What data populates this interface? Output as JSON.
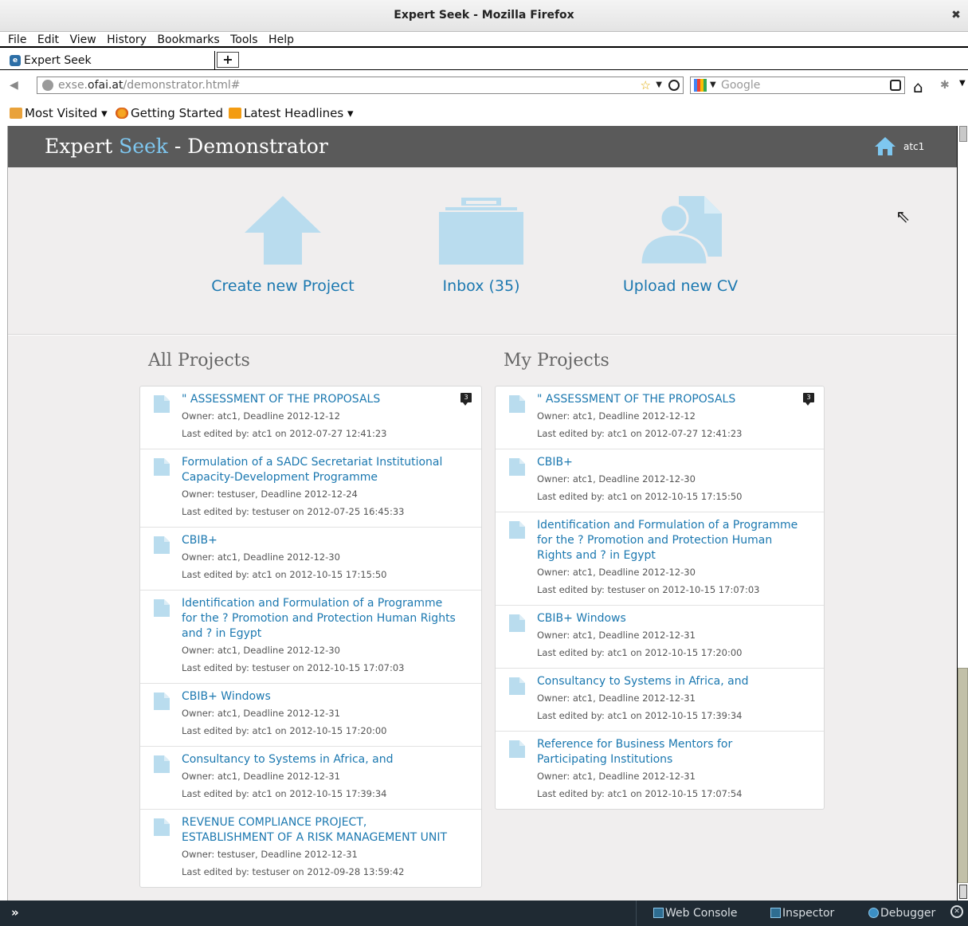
{
  "window": {
    "title": "Expert Seek - Mozilla Firefox"
  },
  "menu": [
    "File",
    "Edit",
    "View",
    "History",
    "Bookmarks",
    "Tools",
    "Help"
  ],
  "tab": {
    "label": "Expert Seek"
  },
  "address_bar": {
    "prefix": "exse.",
    "host": "ofai.at",
    "path": "/demonstrator.html#"
  },
  "search_bar": {
    "placeholder": "Google"
  },
  "bookmarks": [
    "Most Visited ▾",
    "Getting Started",
    "Latest Headlines ▾"
  ],
  "app": {
    "title_part1": "Expert ",
    "title_accent": "Seek",
    "title_part2": " - Demonstrator",
    "user": "atc1"
  },
  "actions": [
    {
      "label": "Create new Project",
      "icon": "arrow-up-icon"
    },
    {
      "label": "Inbox (35)",
      "icon": "inbox-icon"
    },
    {
      "label": "Upload new CV",
      "icon": "upload-cv-icon"
    }
  ],
  "all_projects": {
    "heading": "All Projects",
    "items": [
      {
        "title": "\" ASSESSMENT OF THE PROPOSALS",
        "owner": "Owner: atc1, Deadline 2012-12-12",
        "edited": "Last edited by: atc1 on 2012-07-27 12:41:23",
        "badge": "3"
      },
      {
        "title": "Formulation of a SADC Secretariat Institutional Capacity-Development Programme",
        "owner": "Owner: testuser, Deadline 2012-12-24",
        "edited": "Last edited by: testuser on 2012-07-25 16:45:33"
      },
      {
        "title": "CBIB+",
        "owner": "Owner: atc1, Deadline 2012-12-30",
        "edited": "Last edited by: atc1 on 2012-10-15 17:15:50"
      },
      {
        "title": "Identification and Formulation of a Programme for the ? Promotion and Protection Human Rights and ? in Egypt",
        "owner": "Owner: atc1, Deadline 2012-12-30",
        "edited": "Last edited by: testuser on 2012-10-15 17:07:03"
      },
      {
        "title": "CBIB+ Windows",
        "owner": "Owner: atc1, Deadline 2012-12-31",
        "edited": "Last edited by: atc1 on 2012-10-15 17:20:00"
      },
      {
        "title": "Consultancy to Systems in Africa, and",
        "owner": "Owner: atc1, Deadline 2012-12-31",
        "edited": "Last edited by: atc1 on 2012-10-15 17:39:34"
      },
      {
        "title": "REVENUE COMPLIANCE PROJECT, ESTABLISHMENT OF A RISK MANAGEMENT UNIT",
        "owner": "Owner: testuser, Deadline 2012-12-31",
        "edited": "Last edited by: testuser on 2012-09-28 13:59:42"
      }
    ]
  },
  "my_projects": {
    "heading": "My Projects",
    "items": [
      {
        "title": "\" ASSESSMENT OF THE PROPOSALS",
        "owner": "Owner: atc1, Deadline 2012-12-12",
        "edited": "Last edited by: atc1 on 2012-07-27 12:41:23",
        "badge": "3"
      },
      {
        "title": "CBIB+",
        "owner": "Owner: atc1, Deadline 2012-12-30",
        "edited": "Last edited by: atc1 on 2012-10-15 17:15:50"
      },
      {
        "title": "Identification and Formulation of a Programme for the ? Promotion and Protection Human Rights and ? in Egypt",
        "owner": "Owner: atc1, Deadline 2012-12-30",
        "edited": "Last edited by: testuser on 2012-10-15 17:07:03"
      },
      {
        "title": "CBIB+ Windows",
        "owner": "Owner: atc1, Deadline 2012-12-31",
        "edited": "Last edited by: atc1 on 2012-10-15 17:20:00"
      },
      {
        "title": "Consultancy to Systems in Africa, and",
        "owner": "Owner: atc1, Deadline 2012-12-31",
        "edited": "Last edited by: atc1 on 2012-10-15 17:39:34"
      },
      {
        "title": "Reference for Business Mentors for Participating Institutions",
        "owner": "Owner: atc1, Deadline 2012-12-31",
        "edited": "Last edited by: atc1 on 2012-10-15 17:07:54"
      }
    ]
  },
  "devtools": {
    "web_console": "Web Console",
    "inspector": "Inspector",
    "debugger": "Debugger",
    "toggle": "»"
  },
  "colors": {
    "header_bg": "#5a5a5a",
    "accent": "#7ec7f0",
    "link": "#1b78b0",
    "icon": "#b9dcee",
    "page_bg": "#f0eeee"
  }
}
